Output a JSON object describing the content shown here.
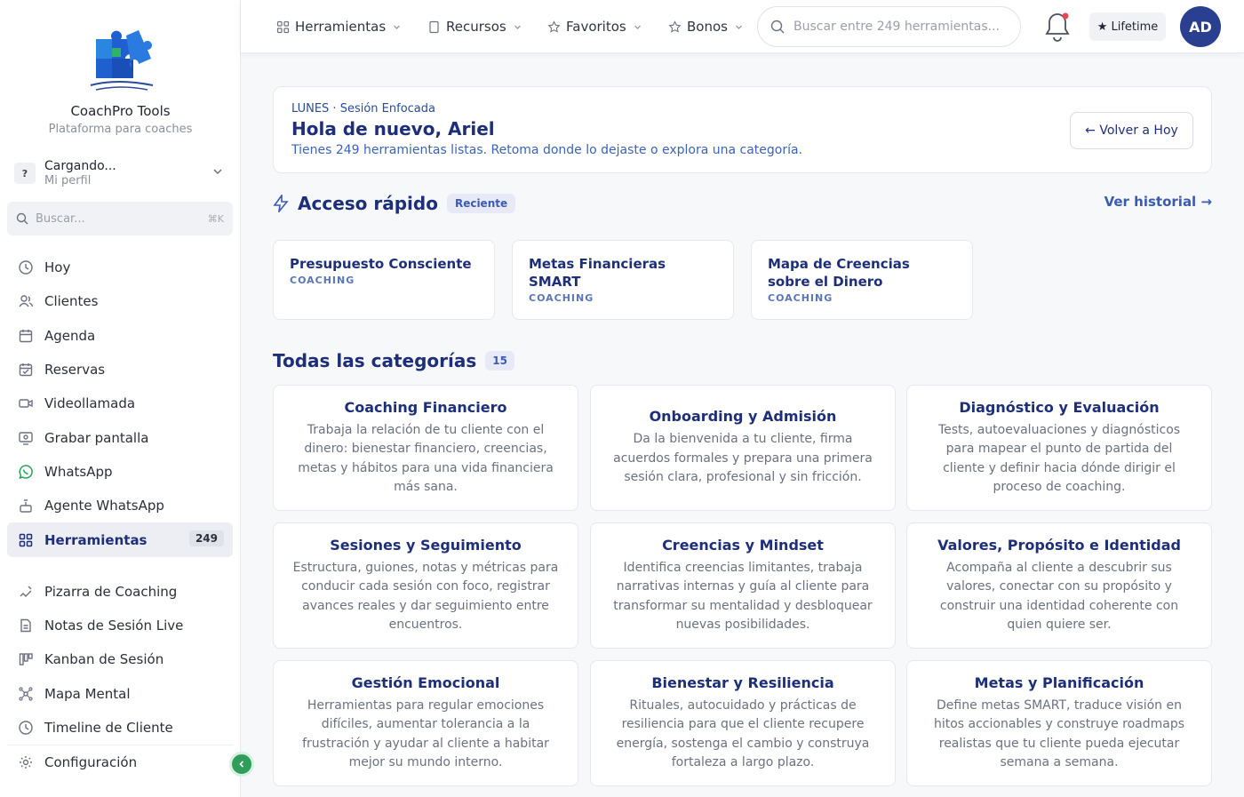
{
  "brand": {
    "name": "CoachPro Tools",
    "subtitle": "Plataforma para coaches"
  },
  "profile": {
    "initial": "?",
    "name": "Cargando...",
    "role": "Mi perfil"
  },
  "sidebar_search": {
    "placeholder": "Buscar...",
    "shortcut": "⌘K"
  },
  "sidebar": {
    "items": [
      {
        "label": "Hoy",
        "icon": "clock-icon"
      },
      {
        "label": "Clientes",
        "icon": "users-icon"
      },
      {
        "label": "Agenda",
        "icon": "calendar-icon"
      },
      {
        "label": "Reservas",
        "icon": "calendar-check-icon"
      },
      {
        "label": "Videollamada",
        "icon": "video-icon"
      },
      {
        "label": "Grabar pantalla",
        "icon": "screen-record-icon"
      },
      {
        "label": "WhatsApp",
        "icon": "whatsapp-icon"
      },
      {
        "label": "Agente WhatsApp",
        "icon": "bot-icon"
      },
      {
        "label": "Herramientas",
        "icon": "grid-icon",
        "badge": "249",
        "active": true
      }
    ],
    "items2": [
      {
        "label": "Pizarra de Coaching",
        "icon": "whiteboard-icon"
      },
      {
        "label": "Notas de Sesión Live",
        "icon": "notes-icon"
      },
      {
        "label": "Kanban de Sesión",
        "icon": "kanban-icon"
      },
      {
        "label": "Mapa Mental",
        "icon": "mindmap-icon"
      },
      {
        "label": "Timeline de Cliente",
        "icon": "clock-icon"
      }
    ],
    "settings_label": "Configuración"
  },
  "topbar": {
    "tools": "Herramientas",
    "resources": "Recursos",
    "favorites": "Favoritos",
    "bonus": "Bonos",
    "search_placeholder": "Buscar entre 249 herramientas...",
    "plan": "★ Lifetime",
    "avatar": "AD"
  },
  "welcome": {
    "eyebrow": "LUNES · Sesión Enfocada",
    "title": "Hola de nuevo, Ariel",
    "subtitle": "Tienes 249 herramientas listas. Retoma donde lo dejaste o explora una categoría.",
    "back_button": "← Volver a Hoy"
  },
  "quick_access": {
    "title": "Acceso rápido",
    "badge": "Reciente",
    "history_link": "Ver historial →",
    "cards": [
      {
        "name": "Presupuesto Consciente",
        "category": "COACHING"
      },
      {
        "name": "Metas Financieras SMART",
        "category": "COACHING"
      },
      {
        "name": "Mapa de Creencias sobre el Dinero",
        "category": "COACHING"
      }
    ]
  },
  "categories": {
    "title": "Todas las categorías",
    "count": "15",
    "items": [
      {
        "name": "Coaching Financiero",
        "desc": "Trabaja la relación de tu cliente con el dinero: bienestar financiero, creencias, metas y hábitos para una vida financiera más sana."
      },
      {
        "name": "Onboarding y Admisión",
        "desc": "Da la bienvenida a tu cliente, firma acuerdos formales y prepara una primera sesión clara, profesional y sin fricción."
      },
      {
        "name": "Diagnóstico y Evaluación",
        "desc": "Tests, autoevaluaciones y diagnósticos para mapear el punto de partida del cliente y definir hacia dónde dirigir el proceso de coaching."
      },
      {
        "name": "Sesiones y Seguimiento",
        "desc": "Estructura, guiones, notas y métricas para conducir cada sesión con foco, registrar avances reales y dar seguimiento entre encuentros."
      },
      {
        "name": "Creencias y Mindset",
        "desc": "Identifica creencias limitantes, trabaja narrativas internas y guía al cliente para transformar su mentalidad y desbloquear nuevas posibilidades."
      },
      {
        "name": "Valores, Propósito e Identidad",
        "desc": "Acompaña al cliente a descubrir sus valores, conectar con su propósito y construir una identidad coherente con quien quiere ser."
      },
      {
        "name": "Gestión Emocional",
        "desc": "Herramientas para regular emociones difíciles, aumentar tolerancia a la frustración y ayudar al cliente a habitar mejor su mundo interno."
      },
      {
        "name": "Bienestar y Resiliencia",
        "desc": "Rituales, autocuidado y prácticas de resiliencia para que el cliente recupere energía, sostenga el cambio y construya fortaleza a largo plazo."
      },
      {
        "name": "Metas y Planificación",
        "desc": "Define metas SMART, traduce visión en hitos accionables y construye roadmaps realistas que tu cliente pueda ejecutar semana a semana."
      }
    ]
  }
}
